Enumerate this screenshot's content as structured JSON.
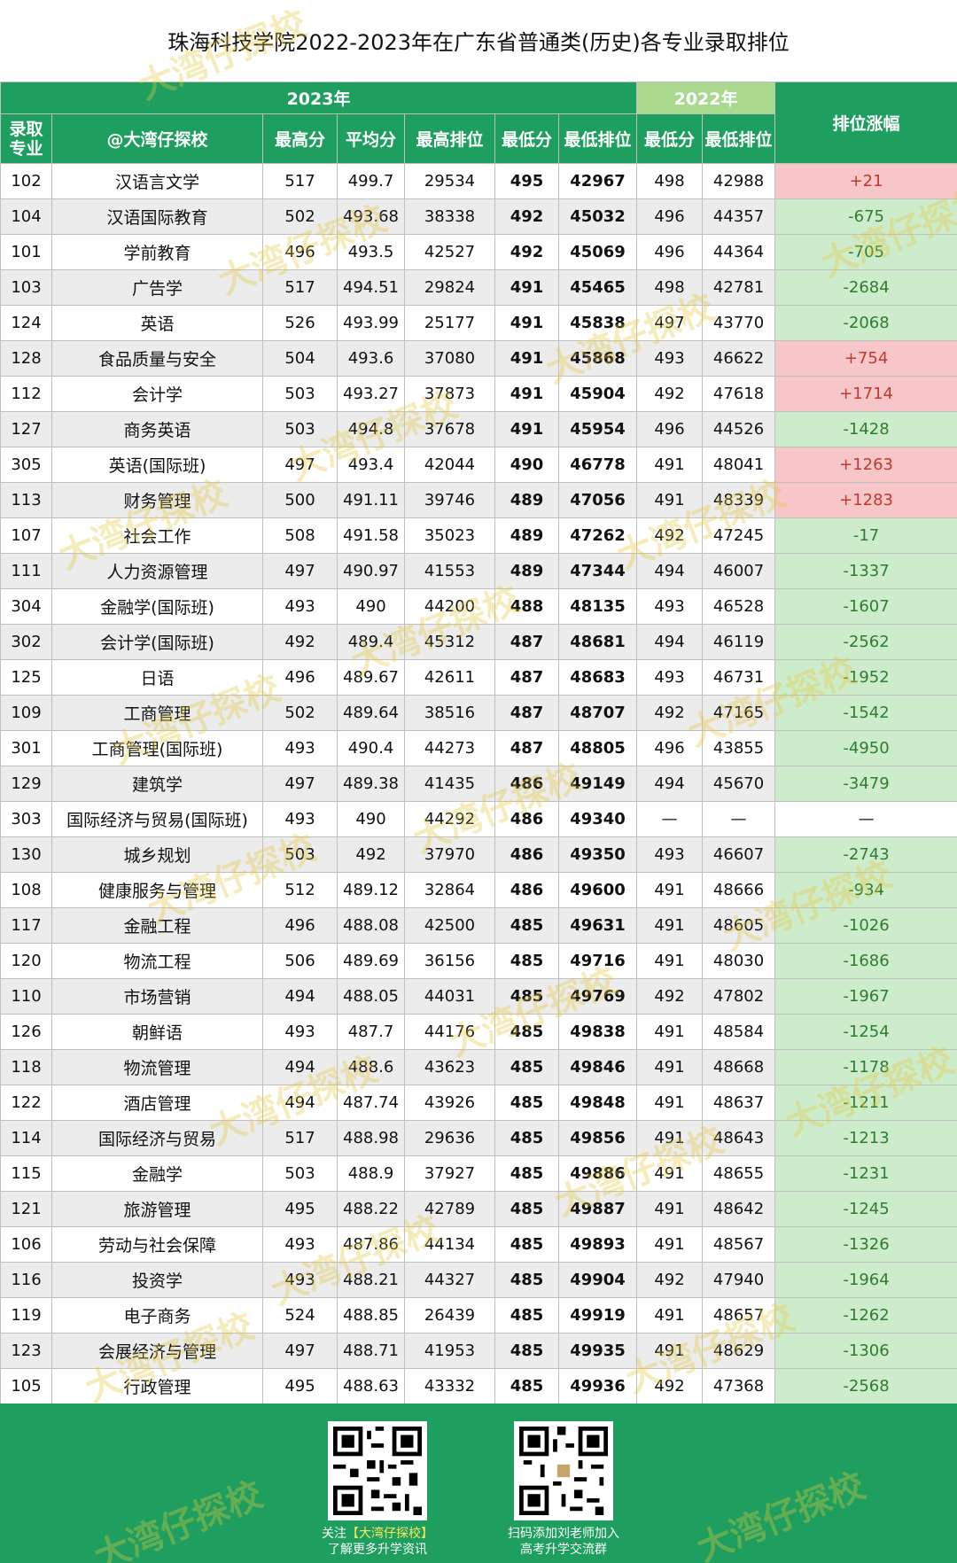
{
  "title": "珠海科技学院2022-2023年在广东省普通类(历史)各专业录取排位",
  "header": {
    "y2023": "2023年",
    "y2022": "2022年",
    "rank_change": "排位涨幅",
    "code_line1": "录取",
    "code_line2": "专业",
    "name": "@大湾仔探校",
    "max_score": "最高分",
    "avg_score": "平均分",
    "max_rank": "最高排位",
    "min_score": "最低分",
    "min_rank": "最低排位",
    "min_score_2022": "最低分",
    "min_rank_2022": "最低排位"
  },
  "rows": [
    {
      "code": "102",
      "name": "汉语言文学",
      "max": "517",
      "avg": "499.7",
      "maxRank": "29534",
      "min": "495",
      "minRank": "42967",
      "min22": "498",
      "minRank22": "42988",
      "change": "+21"
    },
    {
      "code": "104",
      "name": "汉语国际教育",
      "max": "502",
      "avg": "493.68",
      "maxRank": "38338",
      "min": "492",
      "minRank": "45032",
      "min22": "496",
      "minRank22": "44357",
      "change": "-675"
    },
    {
      "code": "101",
      "name": "学前教育",
      "max": "496",
      "avg": "493.5",
      "maxRank": "42527",
      "min": "492",
      "minRank": "45069",
      "min22": "496",
      "minRank22": "44364",
      "change": "-705"
    },
    {
      "code": "103",
      "name": "广告学",
      "max": "517",
      "avg": "494.51",
      "maxRank": "29824",
      "min": "491",
      "minRank": "45465",
      "min22": "498",
      "minRank22": "42781",
      "change": "-2684"
    },
    {
      "code": "124",
      "name": "英语",
      "max": "526",
      "avg": "493.99",
      "maxRank": "25177",
      "min": "491",
      "minRank": "45838",
      "min22": "497",
      "minRank22": "43770",
      "change": "-2068"
    },
    {
      "code": "128",
      "name": "食品质量与安全",
      "max": "504",
      "avg": "493.6",
      "maxRank": "37080",
      "min": "491",
      "minRank": "45868",
      "min22": "493",
      "minRank22": "46622",
      "change": "+754"
    },
    {
      "code": "112",
      "name": "会计学",
      "max": "503",
      "avg": "493.27",
      "maxRank": "37873",
      "min": "491",
      "minRank": "45904",
      "min22": "492",
      "minRank22": "47618",
      "change": "+1714"
    },
    {
      "code": "127",
      "name": "商务英语",
      "max": "503",
      "avg": "494.8",
      "maxRank": "37678",
      "min": "491",
      "minRank": "45954",
      "min22": "496",
      "minRank22": "44526",
      "change": "-1428"
    },
    {
      "code": "305",
      "name": "英语(国际班)",
      "max": "497",
      "avg": "493.4",
      "maxRank": "42044",
      "min": "490",
      "minRank": "46778",
      "min22": "491",
      "minRank22": "48041",
      "change": "+1263"
    },
    {
      "code": "113",
      "name": "财务管理",
      "max": "500",
      "avg": "491.11",
      "maxRank": "39746",
      "min": "489",
      "minRank": "47056",
      "min22": "491",
      "minRank22": "48339",
      "change": "+1283"
    },
    {
      "code": "107",
      "name": "社会工作",
      "max": "508",
      "avg": "491.58",
      "maxRank": "35023",
      "min": "489",
      "minRank": "47262",
      "min22": "492",
      "minRank22": "47245",
      "change": "-17"
    },
    {
      "code": "111",
      "name": "人力资源管理",
      "max": "497",
      "avg": "490.97",
      "maxRank": "41553",
      "min": "489",
      "minRank": "47344",
      "min22": "494",
      "minRank22": "46007",
      "change": "-1337"
    },
    {
      "code": "304",
      "name": "金融学(国际班)",
      "max": "493",
      "avg": "490",
      "maxRank": "44200",
      "min": "488",
      "minRank": "48135",
      "min22": "493",
      "minRank22": "46528",
      "change": "-1607"
    },
    {
      "code": "302",
      "name": "会计学(国际班)",
      "max": "492",
      "avg": "489.4",
      "maxRank": "45312",
      "min": "487",
      "minRank": "48681",
      "min22": "494",
      "minRank22": "46119",
      "change": "-2562"
    },
    {
      "code": "125",
      "name": "日语",
      "max": "496",
      "avg": "489.67",
      "maxRank": "42611",
      "min": "487",
      "minRank": "48683",
      "min22": "493",
      "minRank22": "46731",
      "change": "-1952"
    },
    {
      "code": "109",
      "name": "工商管理",
      "max": "502",
      "avg": "489.64",
      "maxRank": "38516",
      "min": "487",
      "minRank": "48707",
      "min22": "492",
      "minRank22": "47165",
      "change": "-1542"
    },
    {
      "code": "301",
      "name": "工商管理(国际班)",
      "max": "493",
      "avg": "490.4",
      "maxRank": "44273",
      "min": "487",
      "minRank": "48805",
      "min22": "496",
      "minRank22": "43855",
      "change": "-4950"
    },
    {
      "code": "129",
      "name": "建筑学",
      "max": "497",
      "avg": "489.38",
      "maxRank": "41435",
      "min": "486",
      "minRank": "49149",
      "min22": "494",
      "minRank22": "45670",
      "change": "-3479"
    },
    {
      "code": "303",
      "name": "国际经济与贸易(国际班)",
      "max": "493",
      "avg": "490",
      "maxRank": "44292",
      "min": "486",
      "minRank": "49340",
      "min22": "—",
      "minRank22": "—",
      "change": "—"
    },
    {
      "code": "130",
      "name": "城乡规划",
      "max": "503",
      "avg": "492",
      "maxRank": "37970",
      "min": "486",
      "minRank": "49350",
      "min22": "493",
      "minRank22": "46607",
      "change": "-2743"
    },
    {
      "code": "108",
      "name": "健康服务与管理",
      "max": "512",
      "avg": "489.12",
      "maxRank": "32864",
      "min": "486",
      "minRank": "49600",
      "min22": "491",
      "minRank22": "48666",
      "change": "-934"
    },
    {
      "code": "117",
      "name": "金融工程",
      "max": "496",
      "avg": "488.08",
      "maxRank": "42500",
      "min": "485",
      "minRank": "49631",
      "min22": "491",
      "minRank22": "48605",
      "change": "-1026"
    },
    {
      "code": "120",
      "name": "物流工程",
      "max": "506",
      "avg": "489.69",
      "maxRank": "36156",
      "min": "485",
      "minRank": "49716",
      "min22": "491",
      "minRank22": "48030",
      "change": "-1686"
    },
    {
      "code": "110",
      "name": "市场营销",
      "max": "494",
      "avg": "488.05",
      "maxRank": "44031",
      "min": "485",
      "minRank": "49769",
      "min22": "492",
      "minRank22": "47802",
      "change": "-1967"
    },
    {
      "code": "126",
      "name": "朝鲜语",
      "max": "493",
      "avg": "487.7",
      "maxRank": "44176",
      "min": "485",
      "minRank": "49838",
      "min22": "491",
      "minRank22": "48584",
      "change": "-1254"
    },
    {
      "code": "118",
      "name": "物流管理",
      "max": "494",
      "avg": "488.6",
      "maxRank": "43623",
      "min": "485",
      "minRank": "49846",
      "min22": "491",
      "minRank22": "48668",
      "change": "-1178"
    },
    {
      "code": "122",
      "name": "酒店管理",
      "max": "494",
      "avg": "487.74",
      "maxRank": "43926",
      "min": "485",
      "minRank": "49848",
      "min22": "491",
      "minRank22": "48637",
      "change": "-1211"
    },
    {
      "code": "114",
      "name": "国际经济与贸易",
      "max": "517",
      "avg": "488.98",
      "maxRank": "29636",
      "min": "485",
      "minRank": "49856",
      "min22": "491",
      "minRank22": "48643",
      "change": "-1213"
    },
    {
      "code": "115",
      "name": "金融学",
      "max": "503",
      "avg": "488.9",
      "maxRank": "37927",
      "min": "485",
      "minRank": "49886",
      "min22": "491",
      "minRank22": "48655",
      "change": "-1231"
    },
    {
      "code": "121",
      "name": "旅游管理",
      "max": "495",
      "avg": "488.22",
      "maxRank": "42789",
      "min": "485",
      "minRank": "49887",
      "min22": "491",
      "minRank22": "48642",
      "change": "-1245"
    },
    {
      "code": "106",
      "name": "劳动与社会保障",
      "max": "493",
      "avg": "487.86",
      "maxRank": "44134",
      "min": "485",
      "minRank": "49893",
      "min22": "491",
      "minRank22": "48567",
      "change": "-1326"
    },
    {
      "code": "116",
      "name": "投资学",
      "max": "493",
      "avg": "488.21",
      "maxRank": "44327",
      "min": "485",
      "minRank": "49904",
      "min22": "492",
      "minRank22": "47940",
      "change": "-1964"
    },
    {
      "code": "119",
      "name": "电子商务",
      "max": "524",
      "avg": "488.85",
      "maxRank": "26439",
      "min": "485",
      "minRank": "49919",
      "min22": "491",
      "minRank22": "48657",
      "change": "-1262"
    },
    {
      "code": "123",
      "name": "会展经济与管理",
      "max": "497",
      "avg": "488.71",
      "maxRank": "41953",
      "min": "485",
      "minRank": "49935",
      "min22": "491",
      "minRank22": "48629",
      "change": "-1306"
    },
    {
      "code": "105",
      "name": "行政管理",
      "max": "495",
      "avg": "488.63",
      "maxRank": "43332",
      "min": "485",
      "minRank": "49936",
      "min22": "492",
      "minRank22": "47368",
      "change": "-2568"
    }
  ],
  "footer": {
    "left_pre": "关注",
    "left_highlight": "【大湾仔探校】",
    "left_line2": "了解更多升学资讯",
    "right_line1": "扫码添加刘老师加入",
    "right_line2": "高考升学交流群"
  },
  "watermark": "大湾仔探校",
  "colors": {
    "header_green": "#1e9e5f",
    "header_2022": "#a8d98e",
    "increase_bg": "#f7c6c8",
    "decrease_bg": "#cdeccb",
    "watermark": "#e6c83c"
  }
}
